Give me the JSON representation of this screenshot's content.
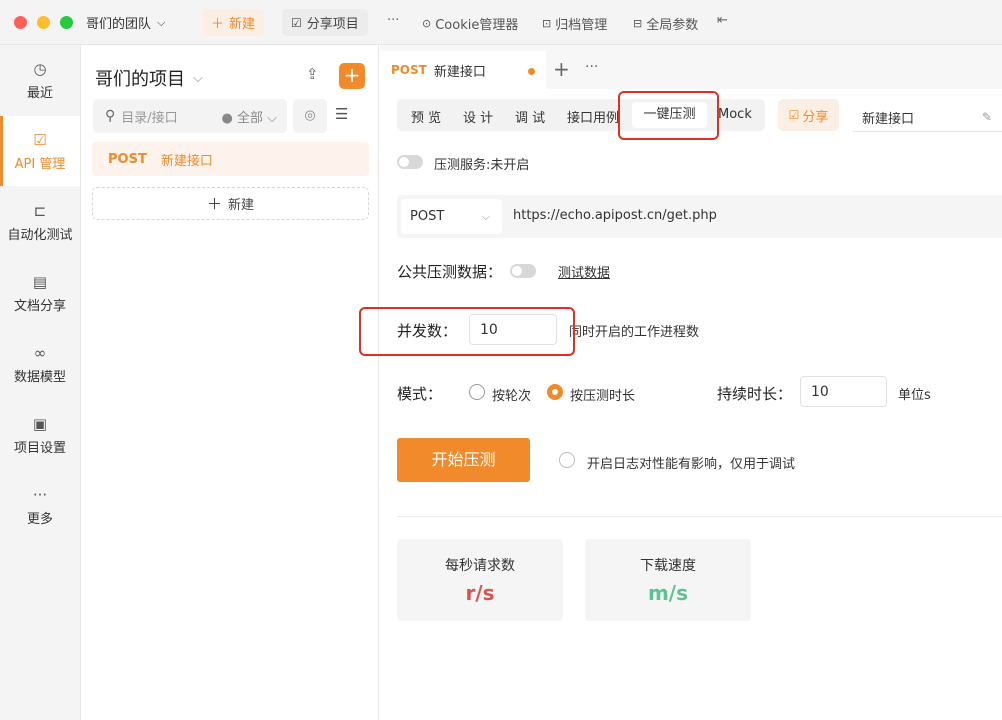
{
  "titlebar": {
    "team_name": "哥们的团队",
    "new_label": "新建",
    "share_project_label": "分享项目",
    "more_label": "···",
    "cookie_label": "Cookie管理器",
    "archive_label": "归档管理",
    "global_params_label": "全局参数"
  },
  "leftnav": {
    "items": [
      {
        "label": "最近",
        "icon": "clock-icon"
      },
      {
        "label": "API 管理",
        "icon": "api-icon"
      },
      {
        "label": "自动化测试",
        "icon": "flow-icon"
      },
      {
        "label": "文档分享",
        "icon": "doc-icon"
      },
      {
        "label": "数据模型",
        "icon": "model-icon"
      },
      {
        "label": "项目设置",
        "icon": "settings-icon"
      },
      {
        "label": "更多",
        "icon": "more-icon"
      }
    ]
  },
  "tree": {
    "project_title": "哥们的项目",
    "search_placeholder": "目录/接口",
    "filter_label": "全部",
    "items": [
      {
        "method": "POST",
        "name": "新建接口"
      }
    ],
    "new_label": "新建"
  },
  "tabs": {
    "active": {
      "method": "POST",
      "name": "新建接口"
    },
    "add_label": "+",
    "more_label": "···"
  },
  "subtabs": {
    "items": [
      "预 览",
      "设 计",
      "调 试",
      "接口用例",
      "一键压测",
      "Mock"
    ],
    "active_index": 4,
    "share_label": "分享",
    "name_value": "新建接口"
  },
  "stress": {
    "service_label": "压测服务:未开启",
    "method": "POST",
    "url": "https://echo.apipost.cn/get.php",
    "public_data_label": "公共压测数据：",
    "test_data_link": "测试数据",
    "concurrency_label": "并发数：",
    "concurrency_value": "10",
    "concurrency_hint": "同时开启的工作进程数",
    "mode_label": "模式：",
    "mode_options": [
      "按轮次",
      "按压测时长"
    ],
    "mode_selected": 1,
    "duration_label": "持续时长：",
    "duration_value": "10",
    "duration_unit": "单位s",
    "start_button": "开始压测",
    "log_hint": "开启日志对性能有影响，仅用于调试"
  },
  "stats": [
    {
      "label": "每秒请求数",
      "value": "r/s",
      "color": "#d9534f"
    },
    {
      "label": "下载速度",
      "value": "m/s",
      "color": "#5cc490"
    }
  ],
  "colors": {
    "accent": "#f08a2a",
    "highlight": "#e0301e"
  }
}
